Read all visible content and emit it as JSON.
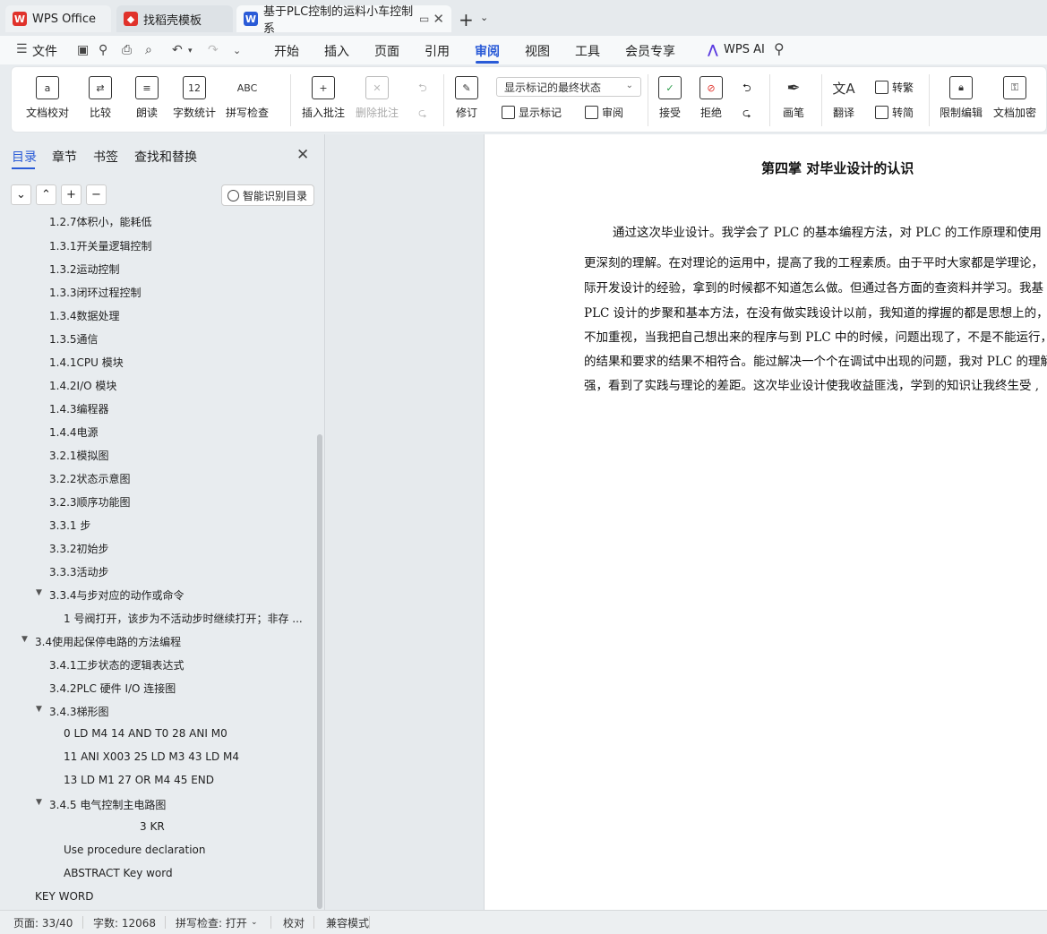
{
  "tabs": [
    {
      "label": "WPS Office"
    },
    {
      "label": "找稻壳模板"
    },
    {
      "label": "基于PLC控制的运料小车控制系"
    }
  ],
  "menu": {
    "file": "文件",
    "items": [
      "开始",
      "插入",
      "页面",
      "引用",
      "审阅",
      "视图",
      "工具",
      "会员专享"
    ],
    "active": "审阅",
    "wps_ai": "WPS AI"
  },
  "ribbon": {
    "proofread": "文档校对",
    "compare": "比较",
    "read_aloud": "朗读",
    "word_count": "字数统计",
    "word_count_icon_text": "12",
    "spell_check": "拼写检查",
    "spell_check_icon_text": "ABC",
    "insert_comment": "插入批注",
    "delete_comment": "删除批注",
    "revise": "修订",
    "markup_state": "显示标记的最终状态",
    "show_markup": "显示标记",
    "review": "审阅",
    "accept": "接受",
    "reject": "拒绝",
    "pen": "画笔",
    "translate": "翻译",
    "to_traditional": "转繁",
    "to_simplified": "转简",
    "restrict_edit": "限制编辑",
    "encrypt": "文档加密"
  },
  "leftpane": {
    "tabs": [
      "目录",
      "章节",
      "书签",
      "查找和替换"
    ],
    "smart_button": "智能识别目录",
    "toc": [
      "1.2.7体积小，能耗低",
      "1.3.1开关量逻辑控制",
      "1.3.2运动控制",
      "1.3.3闭环过程控制",
      "1.3.4数据处理",
      "1.3.5通信",
      "1.4.1CPU 模块",
      "1.4.2I/O 模块",
      "1.4.3编程器",
      "1.4.4电源",
      "3.2.1模拟图",
      "3.2.2状态示意图",
      "3.2.3顺序功能图",
      "3.3.1 步",
      "3.3.2初始步",
      "3.3.3活动步",
      "3.3.4与步对应的动作或命令",
      "1 号阀打开，该步为不活动步时继续打开；非存 ...",
      "3.4使用起保停电路的方法编程",
      "3.4.1工步状态的逻辑表达式",
      "3.4.2PLC 硬件 I/O 连接图",
      "3.4.3梯形图",
      "0 LD M4 14 AND T0 28 ANI M0",
      "11 ANI X003 25 LD M3 43 LD M4",
      "13 LD M1 27 OR M4 45 END",
      "3.4.5 电气控制主电路图",
      "3 KR",
      "Use procedure declaration",
      "ABSTRACT Key word",
      "KEY WORD"
    ]
  },
  "document": {
    "title": "第四掌  对毕业设计的认识",
    "lines": [
      "通过这次毕业设计。我学会了 PLC 的基本编程方法，对 PLC 的工作原理和使用",
      "更深刻的理解。在对理论的运用中，提高了我的工程素质。由于平时大家都是学理论，",
      "际开发设计的经验，拿到的时候都不知道怎么做。但通过各方面的查资料并学习。我基",
      "PLC 设计的步聚和基本方法，在没有做实践设计以前，我知道的撑握的都是思想上的，对",
      "不加重视，当我把自己想出来的程序与到 PLC 中的时候，问题出现了，不是不能运行，",
      "的结果和要求的结果不相符合。能过解决一个个在调试中出现的问题，我对 PLC 的理解",
      "强，看到了实践与理论的差距。这次毕业设计使我收益匪浅，学到的知识让我终生受 ,"
    ]
  },
  "status": {
    "page": "页面: 33/40",
    "words": "字数: 12068",
    "spell": "拼写检查: 打开",
    "proof": "校对",
    "compat": "兼容模式"
  },
  "colors": {
    "accent": "#2a5bd7",
    "wps_red": "#e0322b"
  }
}
